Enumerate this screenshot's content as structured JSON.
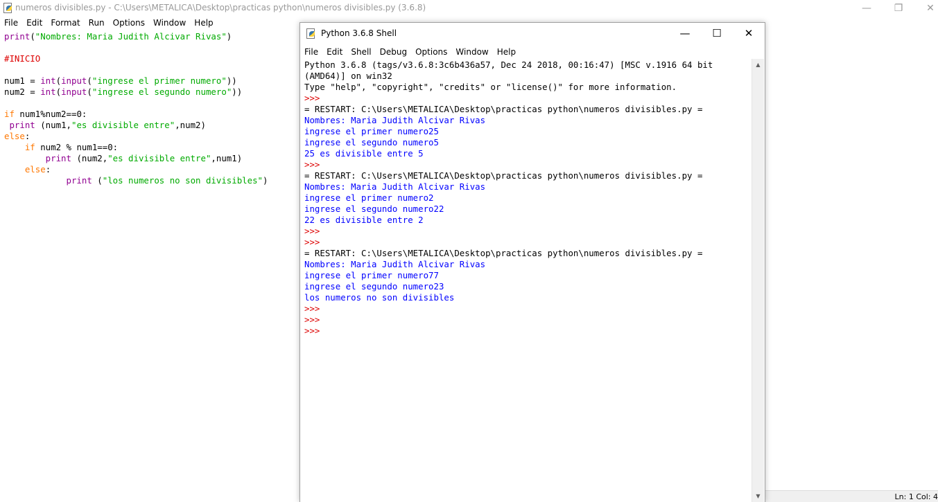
{
  "editor": {
    "title": "numeros divisibles.py - C:\\Users\\METALICA\\Desktop\\practicas python\\numeros divisibles.py (3.6.8)",
    "menu": [
      "File",
      "Edit",
      "Format",
      "Run",
      "Options",
      "Window",
      "Help"
    ],
    "code": {
      "l1": {
        "a": "print",
        "b": "(",
        "c": "\"Nombres: Maria Judith Alcivar Rivas\"",
        "d": ")"
      },
      "l3": "#INICIO",
      "l5": {
        "a": "num1 = ",
        "b": "int",
        "c": "(",
        "d": "input",
        "e": "(",
        "f": "\"ingrese el primer numero\"",
        "g": "))"
      },
      "l6": {
        "a": "num2 = ",
        "b": "int",
        "c": "(",
        "d": "input",
        "e": "(",
        "f": "\"ingrese el segundo numero\"",
        "g": "))"
      },
      "l8": {
        "a": "if",
        "b": " num1%num2==0:"
      },
      "l9": {
        "a": " print",
        "b": " (num1,",
        "c": "\"es divisible entre\"",
        "d": ",num2)"
      },
      "l10": {
        "a": "else",
        "b": ":"
      },
      "l11": {
        "a": "    if",
        "b": " num2 % num1==0:"
      },
      "l12": {
        "a": "        print",
        "b": " (num2,",
        "c": "\"es divisible entre\"",
        "d": ",num1)"
      },
      "l13": {
        "a": "    else",
        "b": ":"
      },
      "l14": {
        "a": "            print",
        "b": " (",
        "c": "\"los numeros no son divisibles\"",
        "d": ")"
      }
    },
    "status": "Ln: 1   Col: 4"
  },
  "shell": {
    "title": "Python 3.6.8 Shell",
    "menu": [
      "File",
      "Edit",
      "Shell",
      "Debug",
      "Options",
      "Window",
      "Help"
    ],
    "lines": {
      "banner1": "Python 3.6.8 (tags/v3.6.8:3c6b436a57, Dec 24 2018, 00:16:47) [MSC v.1916 64 bit",
      "banner2": "(AMD64)] on win32",
      "banner3": "Type \"help\", \"copyright\", \"credits\" or \"license()\" for more information.",
      "prompt": ">>> ",
      "restart": "= RESTART: C:\\Users\\METALICA\\Desktop\\practicas python\\numeros divisibles.py =",
      "name": "Nombres: Maria Judith Alcivar Rivas",
      "r1a": "ingrese el primer numero25",
      "r1b": "ingrese el segundo numero5",
      "r1c": "25 es divisible entre 5",
      "r2a": "ingrese el primer numero2",
      "r2b": "ingrese el segundo numero22",
      "r2c": "22 es divisible entre 2",
      "r3a": "ingrese el primer numero77",
      "r3b": "ingrese el segundo numero23",
      "r3c": "los numeros no son divisibles"
    }
  },
  "colors": {
    "keyword": "#ff7700",
    "builtin": "#900090",
    "string": "#00aa00",
    "comment": "#dd0000",
    "stdout": "#0000ff"
  }
}
